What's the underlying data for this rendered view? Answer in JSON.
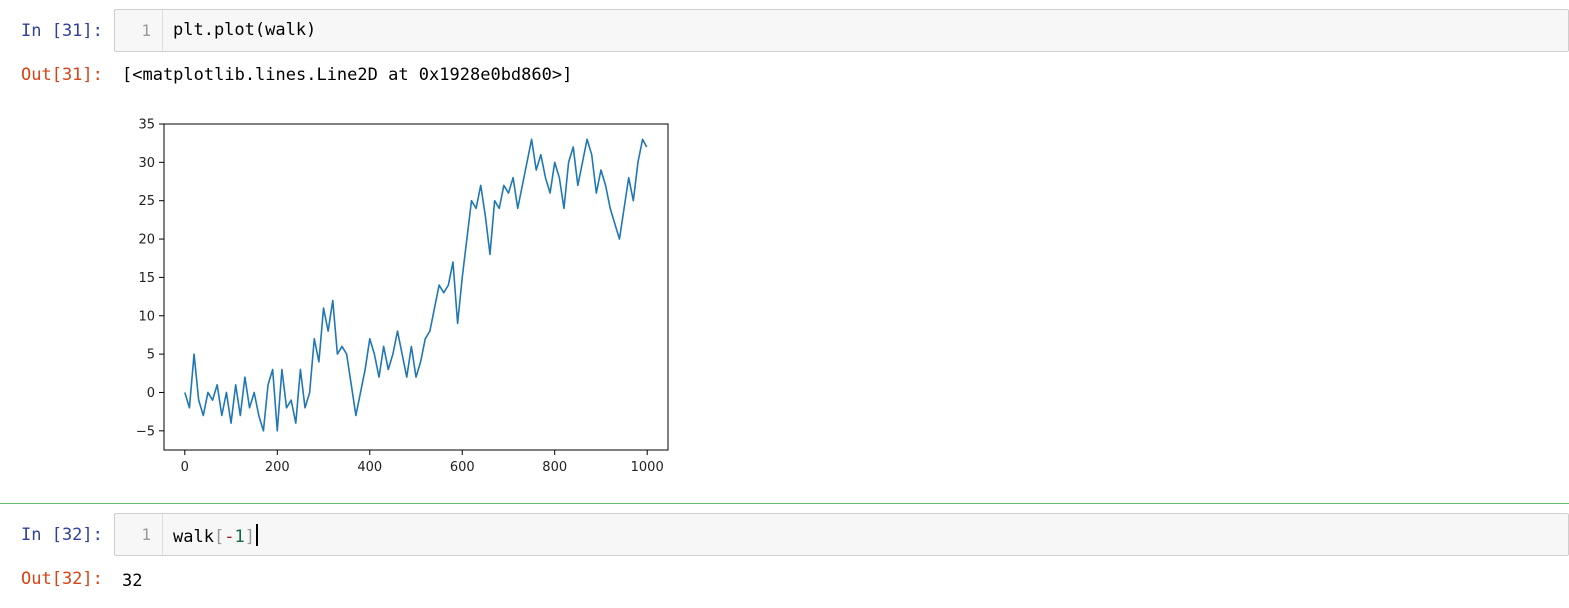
{
  "cells": [
    {
      "in_prompt": "In [31]:",
      "line_number": "1",
      "code": "plt.plot(walk)",
      "out_prompt": "Out[31]:",
      "output_text": "[<matplotlib.lines.Line2D at 0x1928e0bd860>]"
    },
    {
      "in_prompt": "In [32]:",
      "line_number": "1",
      "code_name": "walk",
      "code_open": "[",
      "code_op": "-",
      "code_num": "1",
      "code_close": "]",
      "out_prompt": "Out[32]:",
      "output_text": "32"
    }
  ],
  "colors": {
    "line": "#1f77b4",
    "in_prompt": "#303f9f",
    "out_prompt": "#d84315",
    "selected_border": "#66bb6a"
  },
  "chart_data": {
    "type": "line",
    "title": "",
    "xlabel": "",
    "ylabel": "",
    "xlim": [
      -45,
      1045
    ],
    "ylim": [
      -7.5,
      35
    ],
    "xticks": [
      0,
      200,
      400,
      600,
      800,
      1000
    ],
    "yticks": [
      -5,
      0,
      5,
      10,
      15,
      20,
      25,
      30,
      35
    ],
    "xtick_labels": [
      "0",
      "200",
      "400",
      "600",
      "800",
      "1000"
    ],
    "ytick_labels": [
      "−5",
      "0",
      "5",
      "10",
      "15",
      "20",
      "25",
      "30",
      "35"
    ],
    "grid": false,
    "series": [
      {
        "x": [
          0,
          10,
          20,
          30,
          40,
          50,
          60,
          70,
          80,
          90,
          100,
          110,
          120,
          130,
          140,
          150,
          160,
          170,
          180,
          190,
          200,
          210,
          220,
          230,
          240,
          250,
          260,
          270,
          280,
          290,
          300,
          310,
          320,
          330,
          340,
          350,
          360,
          370,
          380,
          390,
          400,
          410,
          420,
          430,
          440,
          450,
          460,
          470,
          480,
          490,
          500,
          510,
          520,
          530,
          540,
          550,
          560,
          570,
          580,
          590,
          600,
          610,
          620,
          630,
          640,
          650,
          660,
          670,
          680,
          690,
          700,
          710,
          720,
          730,
          740,
          750,
          760,
          770,
          780,
          790,
          800,
          810,
          820,
          830,
          840,
          850,
          860,
          870,
          880,
          890,
          900,
          910,
          920,
          930,
          940,
          950,
          960,
          970,
          980,
          990,
          999
        ],
        "y": [
          0,
          -2,
          5,
          -1,
          -3,
          0,
          -1,
          1,
          -3,
          0,
          -4,
          1,
          -3,
          2,
          -2,
          0,
          -3,
          -5,
          1,
          3,
          -5,
          3,
          -2,
          -1,
          -4,
          3,
          -2,
          0,
          7,
          4,
          11,
          8,
          12,
          5,
          6,
          5,
          1,
          -3,
          0,
          3,
          7,
          5,
          2,
          6,
          3,
          5,
          8,
          5,
          2,
          6,
          2,
          4,
          7,
          8,
          11,
          14,
          13,
          14,
          17,
          9,
          15,
          20,
          25,
          24,
          27,
          23,
          18,
          25,
          24,
          27,
          26,
          28,
          24,
          27,
          30,
          33,
          29,
          31,
          28,
          26,
          30,
          28,
          24,
          30,
          32,
          27,
          30,
          33,
          31,
          26,
          29,
          27,
          24,
          22,
          20,
          24,
          28,
          25,
          30,
          33,
          32
        ]
      }
    ]
  }
}
